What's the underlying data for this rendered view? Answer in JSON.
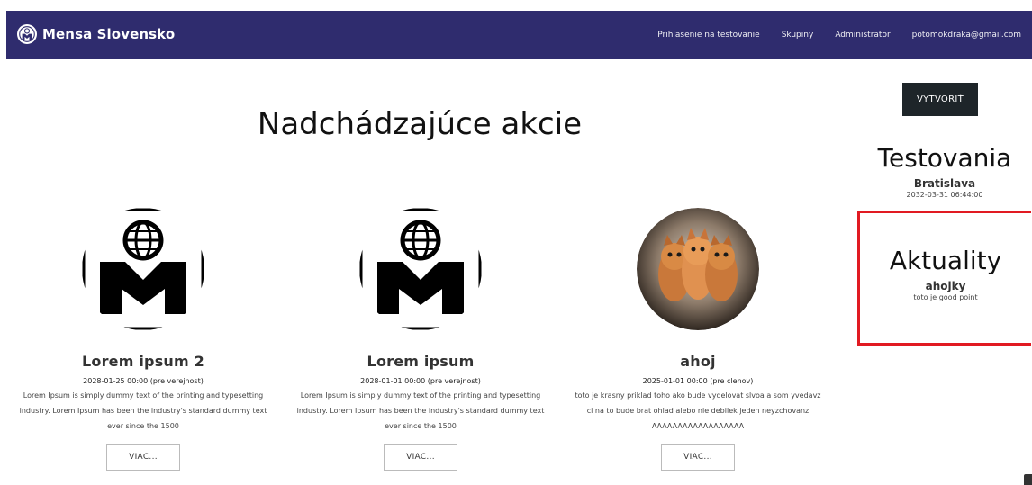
{
  "nav": {
    "brand": "Mensa Slovensko",
    "links": [
      "Prihlasenie na testovanie",
      "Skupiny",
      "Administrator",
      "potomokdraka@gmail.com"
    ]
  },
  "main": {
    "title": "Nadchádzajúce akcie",
    "events": [
      {
        "title": "Lorem ipsum 2",
        "meta": "2028-01-25 00:00 (pre verejnost)",
        "description": "Lorem Ipsum is simply dummy text of the printing and typesetting industry. Lorem Ipsum has been the industry's standard dummy text ever since the 1500",
        "button": "VIAC..."
      },
      {
        "title": "Lorem ipsum",
        "meta": "2028-01-01 00:00 (pre verejnost)",
        "description": "Lorem Ipsum is simply dummy text of the printing and typesetting industry. Lorem Ipsum has been the industry's standard dummy text ever since the 1500",
        "button": "VIAC..."
      },
      {
        "title": "ahoj",
        "meta": "2025-01-01 00:00 (pre clenov)",
        "description": "toto je krasny priklad toho ako bude vydelovat slvoa a som yvedavz ci na to bude brat ohlad alebo nie debilek jeden neyzchovanz AAAAAAAAAAAAAAAAAA",
        "button": "VIAC..."
      }
    ]
  },
  "sidebar": {
    "create_button": "VYTVORIŤ",
    "testing": {
      "title": "Testovania",
      "city": "Bratislava",
      "date": "2032-03-31 06:44:00"
    },
    "news": {
      "title": "Aktuality",
      "item": "ahojky",
      "text": "toto je good point"
    }
  },
  "colors": {
    "navbar": "#2f2c6e",
    "highlight_border": "#e11a22",
    "create_button": "#1e2529"
  }
}
